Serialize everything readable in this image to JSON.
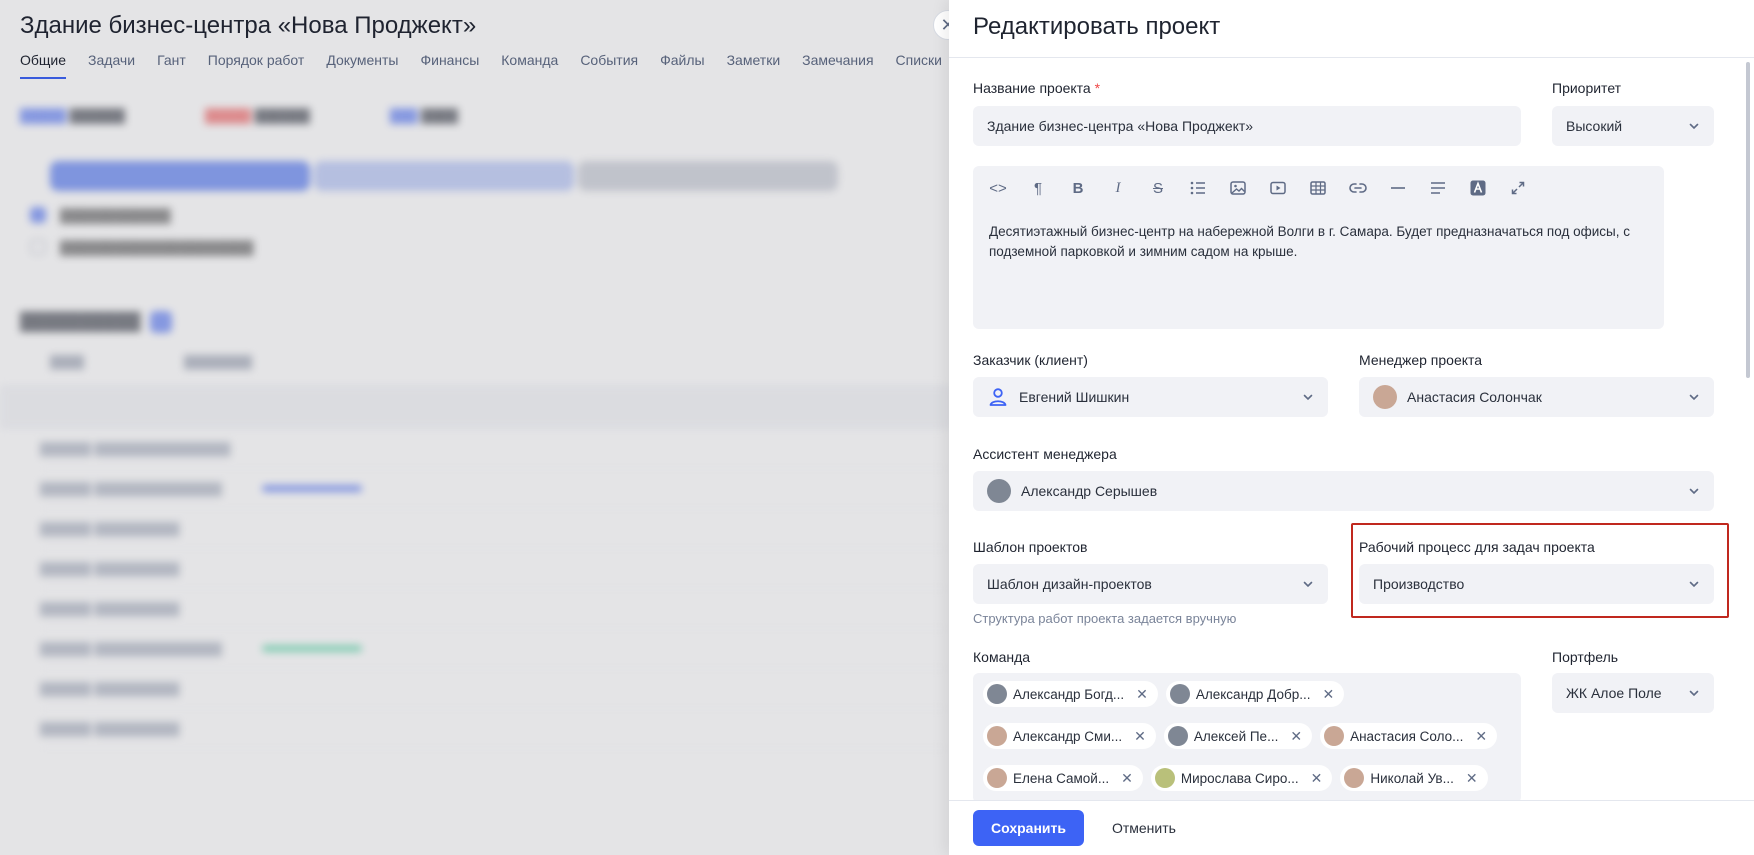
{
  "background": {
    "title": "Здание бизнес-центра «Нова Проджект»",
    "tabs": [
      "Общие",
      "Задачи",
      "Гант",
      "Порядок работ",
      "Документы",
      "Финансы",
      "Команда",
      "События",
      "Файлы",
      "Заметки",
      "Замечания",
      "Списки"
    ]
  },
  "drawer": {
    "title": "Редактировать проект",
    "close_glyph": "✕",
    "project_name": {
      "label": "Название проекта",
      "required_mark": "*",
      "value": "Здание бизнес-центра «Нова Проджект»"
    },
    "priority": {
      "label": "Приоритет",
      "value": "Высокий"
    },
    "description": "Десятиэтажный бизнес-центр на набережной Волги в г. Самара. Будет предназначаться под офисы, с подземной парковкой и зимним садом на крыше.",
    "customer": {
      "label": "Заказчик (клиент)",
      "value": "Евгений Шишкин"
    },
    "manager": {
      "label": "Менеджер проекта",
      "value": "Анастасия Солончак"
    },
    "assistant": {
      "label": "Ассистент менеджера",
      "value": "Александр Серышев"
    },
    "template": {
      "label": "Шаблон проектов",
      "value": "Шаблон дизайн-проектов",
      "hint": "Структура работ проекта задается вручную"
    },
    "workflow": {
      "label": "Рабочий процесс для задач проекта",
      "value": "Производство"
    },
    "team": {
      "label": "Команда",
      "members": [
        "Александр Богд...",
        "Александр Добр...",
        "Александр Сми...",
        "Алексей Пе...",
        "Анастасия Соло...",
        "Елена Самой...",
        "Мирослава Сиро...",
        "Николай Ув..."
      ]
    },
    "portfolio": {
      "label": "Портфель",
      "value": "ЖК Алое Поле"
    },
    "save_label": "Сохранить",
    "cancel_label": "Отменить"
  },
  "colors": {
    "accent": "#3d63f5",
    "highlight": "#c0281e",
    "required": "#f04747"
  }
}
